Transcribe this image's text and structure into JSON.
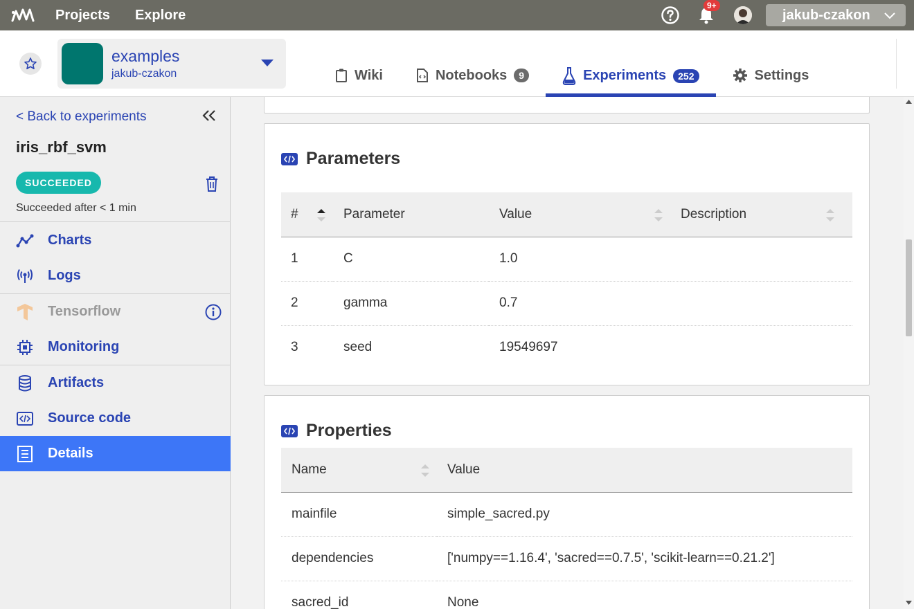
{
  "topbar": {
    "projects": "Projects",
    "explore": "Explore",
    "notifications_badge": "9+",
    "username": "jakub-czakon"
  },
  "project": {
    "name": "examples",
    "owner": "jakub-czakon",
    "avatar_color": "#00766e"
  },
  "tabs": [
    {
      "label": "Wiki",
      "icon": "clipboard-icon"
    },
    {
      "label": "Notebooks",
      "icon": "notebook-icon",
      "count": "9"
    },
    {
      "label": "Experiments",
      "icon": "flask-icon",
      "count": "252",
      "active": true
    },
    {
      "label": "Settings",
      "icon": "gear-icon"
    }
  ],
  "sidebar": {
    "back": "< Back to experiments",
    "experiment_name": "iris_rbf_svm",
    "status": "SUCCEEDED",
    "status_text": "Succeeded after < 1 min",
    "items": [
      {
        "label": "Charts",
        "icon": "chart-icon"
      },
      {
        "label": "Logs",
        "icon": "broadcast-icon"
      },
      {
        "label": "Tensorflow",
        "icon": "tensorflow-icon"
      },
      {
        "label": "Monitoring",
        "icon": "chip-icon"
      },
      {
        "label": "Artifacts",
        "icon": "database-icon"
      },
      {
        "label": "Source code",
        "icon": "code-icon"
      },
      {
        "label": "Details",
        "icon": "document-icon"
      }
    ]
  },
  "parameters": {
    "title": "Parameters",
    "headers": [
      "#",
      "Parameter",
      "Value",
      "Description"
    ],
    "rows": [
      {
        "num": "1",
        "name": "C",
        "value": "1.0",
        "desc": ""
      },
      {
        "num": "2",
        "name": "gamma",
        "value": "0.7",
        "desc": ""
      },
      {
        "num": "3",
        "name": "seed",
        "value": "19549697",
        "desc": ""
      }
    ]
  },
  "properties": {
    "title": "Properties",
    "headers": [
      "Name",
      "Value"
    ],
    "rows": [
      {
        "name": "mainfile",
        "value": "simple_sacred.py"
      },
      {
        "name": "dependencies",
        "value": "['numpy==1.16.4', 'sacred==0.7.5', 'scikit-learn==0.21.2']"
      },
      {
        "name": "sacred_id",
        "value": "None"
      }
    ]
  },
  "colors": {
    "accent": "#2a44b3",
    "active_nav": "#3d76f7",
    "success": "#17b8ad",
    "topbar": "#6b6b63"
  }
}
